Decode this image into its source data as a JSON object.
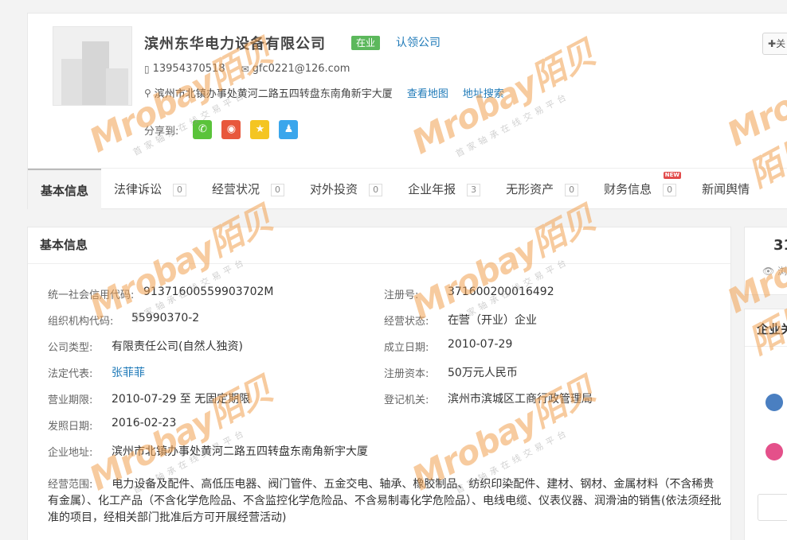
{
  "company": {
    "name": "滨州东华电力设备有限公司",
    "status": "在业",
    "claim_label": "认领公司",
    "follow_label": "关",
    "phone": "13954370518",
    "email": "gfc0221@126.com",
    "address": "滨州市北镇办事处黄河二路五四转盘东南角新宇大厦",
    "map_link": "查看地图",
    "address_search_link": "地址搜索",
    "share_label": "分享到:"
  },
  "share_buttons": [
    {
      "name": "wechat",
      "color": "#5ac33a",
      "glyph": "✆"
    },
    {
      "name": "weibo",
      "color": "#e8583c",
      "glyph": "◉"
    },
    {
      "name": "qzone",
      "color": "#f4c522",
      "glyph": "★"
    },
    {
      "name": "qq",
      "color": "#3aa6ec",
      "glyph": "♟"
    }
  ],
  "tabs": [
    {
      "label": "基本信息",
      "count": ""
    },
    {
      "label": "法律诉讼",
      "count": "0"
    },
    {
      "label": "经营状况",
      "count": "0"
    },
    {
      "label": "对外投资",
      "count": "0"
    },
    {
      "label": "企业年报",
      "count": "3"
    },
    {
      "label": "无形资产",
      "count": "0"
    },
    {
      "label": "财务信息",
      "count": "0",
      "badge": "NEW"
    },
    {
      "label": "新闻舆情",
      "count": ""
    }
  ],
  "basic_info": {
    "title": "基本信息",
    "credit_code_label": "统一社会信用代码:",
    "credit_code": "91371600559903702M",
    "reg_no_label": "注册号:",
    "reg_no": "371600200016492",
    "org_code_label": "组织机构代码:",
    "org_code": "55990370-2",
    "op_status_label": "经营状态:",
    "op_status": "在营（开业）企业",
    "company_type_label": "公司类型:",
    "company_type": "有限责任公司(自然人独资)",
    "established_label": "成立日期:",
    "established": "2010-07-29",
    "legal_rep_label": "法定代表:",
    "legal_rep": "张菲菲",
    "reg_capital_label": "注册资本:",
    "reg_capital": "50万元人民币",
    "term_label": "营业期限:",
    "term": "2010-07-29 至 无固定期限",
    "reg_authority_label": "登记机关:",
    "reg_authority": "滨州市滨城区工商行政管理局",
    "issue_date_label": "发照日期:",
    "issue_date": "2016-02-23",
    "address_label": "企业地址:",
    "address": "滨州市北镇办事处黄河二路五四转盘东南角新宇大厦",
    "scope_label": "经营范围:",
    "scope": "电力设备及配件、高低压电器、阀门管件、五金交电、轴承、橡胶制品、纺织印染配件、建材、钢材、金属材料（不含稀贵有金属）、化工产品（不含化学危险品、不含监控化学危险品、不含易制毒化学危险品）、电线电缆、仪表仪器、润滑油的销售(依法须经批准的项目，经相关部门批准后方可开展经营活动)"
  },
  "side": {
    "count": "31",
    "views_label": "浏",
    "related_title": "企业关"
  },
  "watermark": {
    "brand_a": "Mro",
    "brand_b": "bay",
    "brand_cn": "陌贝",
    "slogan": "首家轴承在线交易平台"
  }
}
